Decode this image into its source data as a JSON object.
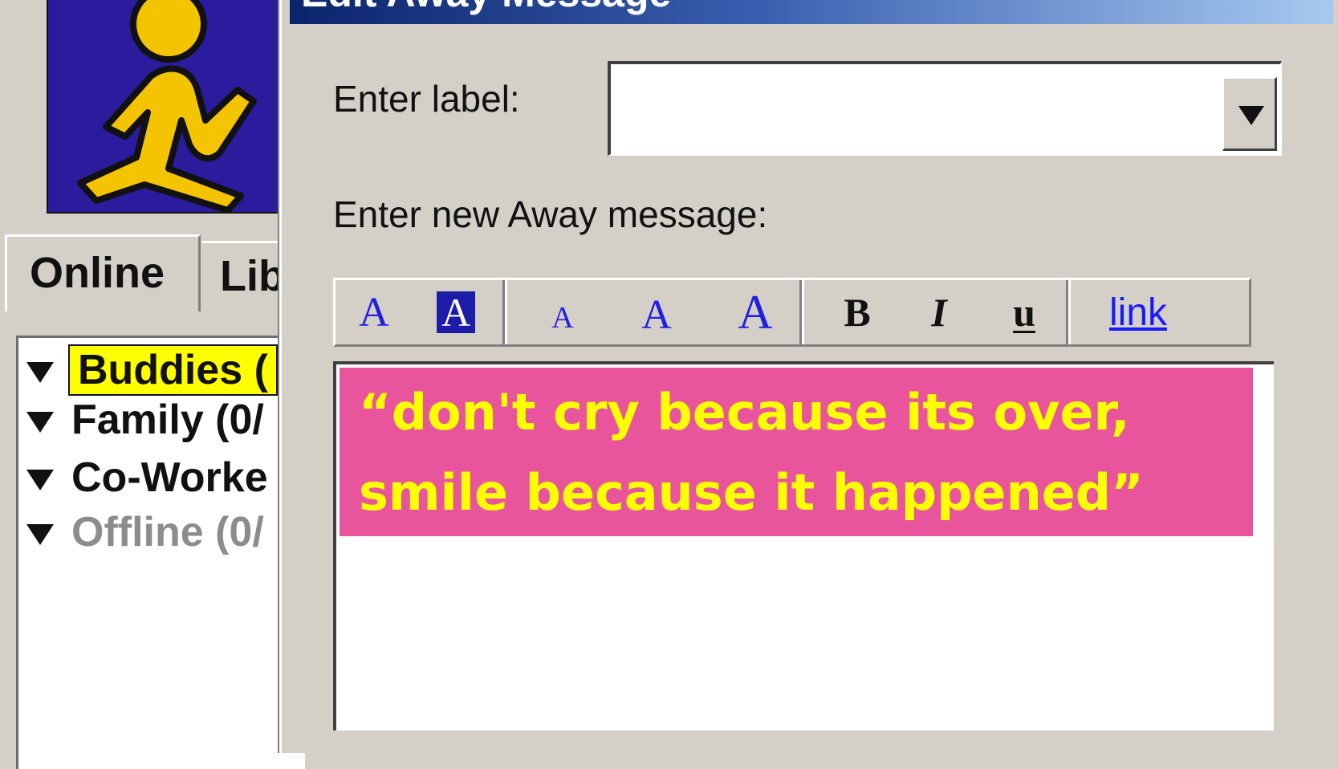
{
  "buddy_list": {
    "tabs": [
      "Online",
      "Lib"
    ],
    "groups": [
      {
        "label": "Buddies (",
        "state": "expanded",
        "highlight": "#ffff00"
      },
      {
        "label": "Family (0/",
        "state": "expanded"
      },
      {
        "label": "Co-Worke",
        "state": "expanded"
      },
      {
        "label": "Offline (0/",
        "state": "expanded",
        "color": "#8c8c8c"
      }
    ],
    "logo_colors": {
      "background": "#2a1c9c",
      "figure": "#f5c400"
    }
  },
  "dialog": {
    "title": "Edit Away Message",
    "label_caption": "Enter label:",
    "label_value": "",
    "message_caption": "Enter new Away message:",
    "toolbar": {
      "font_color": "A",
      "background_color": "A",
      "size_small": "A",
      "size_medium": "A",
      "size_large": "A",
      "bold": "B",
      "italic": "I",
      "underline": "u",
      "link": "link"
    },
    "message": {
      "text": "“don't cry because its over,\nsmile because it happened”",
      "background": "#e8559c",
      "text_color": "#ffff00"
    }
  }
}
